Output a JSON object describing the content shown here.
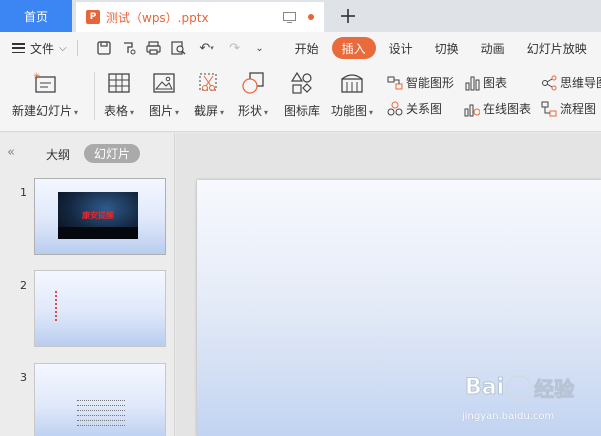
{
  "tabs": {
    "home": "首页",
    "doc_title": "测试（wps）.pptx",
    "doc_icon": "P"
  },
  "menu": {
    "file_label": "文件",
    "ribbon_tabs": [
      "开始",
      "插入",
      "设计",
      "切换",
      "动画",
      "幻灯片放映"
    ],
    "active_tab": "插入",
    "quick_access_icons": [
      "save-icon",
      "format-painter-icon",
      "print-icon",
      "print-preview-icon",
      "undo-icon",
      "redo-icon",
      "more-icon"
    ]
  },
  "ribbon": {
    "new_slide": "新建幻灯片",
    "table": "表格",
    "picture": "图片",
    "screenshot": "截屏",
    "shape": "形状",
    "icon_library": "图标库",
    "function_chart": "功能图",
    "smart_art": "智能图形",
    "chart": "图表",
    "mind_map": "思维导图",
    "relation_chart": "关系图",
    "online_chart": "在线图表",
    "flowchart": "流程图"
  },
  "panel": {
    "collapse": "«",
    "outline_tab": "大纲",
    "slides_tab": "幻灯片",
    "slides": [
      {
        "number": "1",
        "title": "康安提醒"
      },
      {
        "number": "2"
      },
      {
        "number": "3"
      }
    ]
  },
  "watermark": {
    "brand_left": "Bai",
    "brand_right": "经验",
    "url": "jingyan.baidu.com"
  },
  "colors": {
    "home_tab": "#3c86f3",
    "accent": "#e96a3b"
  }
}
